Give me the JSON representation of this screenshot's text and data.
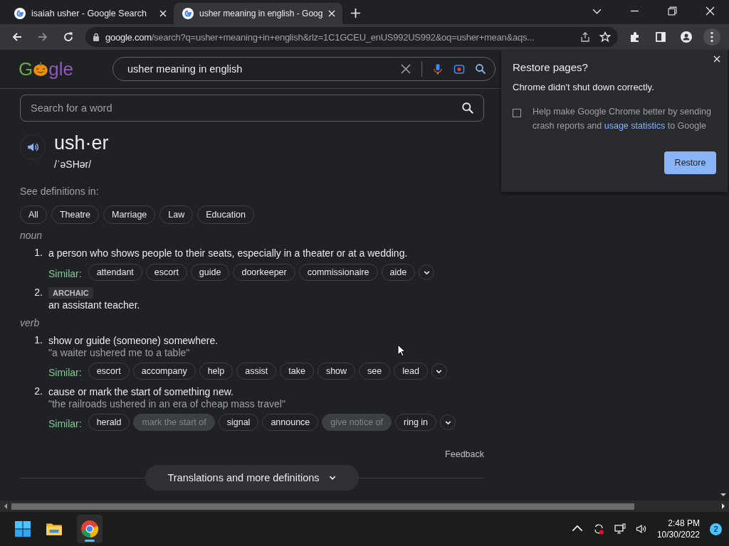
{
  "tabs": [
    {
      "title": "isaiah usher - Google Search",
      "selected": false
    },
    {
      "title": "usher meaning in english - Goog",
      "selected": true
    }
  ],
  "address_bar": {
    "domain": "google.com",
    "path": "/search?q=usher+meaning+in+english&rlz=1C1GCEU_enUS992US992&oq=usher+mean&aqs..."
  },
  "google_header": {
    "logo_before": "G",
    "logo_after": "gle",
    "query": "usher meaning in english"
  },
  "dictionary": {
    "search_placeholder": "Search for a word",
    "word": "ush·er",
    "phonetic": "/ˈəSHər/",
    "see_definitions_label": "See definitions in:",
    "filters": [
      {
        "label": "All",
        "selected": false
      },
      {
        "label": "Theatre",
        "selected": false
      },
      {
        "label": "Marriage",
        "selected": false
      },
      {
        "label": "Law",
        "selected": false
      },
      {
        "label": "Education",
        "selected": false
      }
    ],
    "parts_of_speech": [
      {
        "pos": "noun",
        "senses": [
          {
            "number": "1.",
            "text": "a person who shows people to their seats, especially in a theater or at a wedding.",
            "similar_label": "Similar:",
            "similar": [
              {
                "word": "attendant",
                "dimmed": false
              },
              {
                "word": "escort",
                "dimmed": false
              },
              {
                "word": "guide",
                "dimmed": false
              },
              {
                "word": "doorkeeper",
                "dimmed": false
              },
              {
                "word": "commissionaire",
                "dimmed": false
              },
              {
                "word": "aide",
                "dimmed": false
              }
            ]
          },
          {
            "number": "2.",
            "tag": "ARCHAIC",
            "text": "an assistant teacher."
          }
        ]
      },
      {
        "pos": "verb",
        "senses": [
          {
            "number": "1.",
            "text": "show or guide (someone) somewhere.",
            "example": "\"a waiter ushered me to a table\"",
            "similar_label": "Similar:",
            "similar": [
              {
                "word": "escort",
                "dimmed": false
              },
              {
                "word": "accompany",
                "dimmed": false
              },
              {
                "word": "help",
                "dimmed": false
              },
              {
                "word": "assist",
                "dimmed": false
              },
              {
                "word": "take",
                "dimmed": false
              },
              {
                "word": "show",
                "dimmed": false
              },
              {
                "word": "see",
                "dimmed": false
              },
              {
                "word": "lead",
                "dimmed": false
              }
            ]
          },
          {
            "number": "2.",
            "text": "cause or mark the start of something new.",
            "example": "\"the railroads ushered in an era of cheap mass travel\"",
            "similar_label": "Similar:",
            "similar": [
              {
                "word": "herald",
                "dimmed": false
              },
              {
                "word": "mark the start of",
                "dimmed": true
              },
              {
                "word": "signal",
                "dimmed": false
              },
              {
                "word": "announce",
                "dimmed": false
              },
              {
                "word": "give notice of",
                "dimmed": true
              },
              {
                "word": "ring in",
                "dimmed": false
              }
            ]
          }
        ]
      }
    ],
    "feedback": "Feedback",
    "more_button": "Translations and more definitions"
  },
  "restore_popup": {
    "title": "Restore pages?",
    "message": "Chrome didn't shut down correctly.",
    "checkbox_text_before": "Help make Google Chrome better by sending crash reports and",
    "checkbox_link": "usage statistics",
    "checkbox_text_after": "to Google",
    "checked": false,
    "button": "Restore"
  },
  "taskbar": {
    "apps": [
      {
        "kind": "explorer",
        "active": false
      },
      {
        "kind": "chrome",
        "active": true
      }
    ],
    "time": "2:48 PM",
    "date": "10/30/2022",
    "notifications": "2"
  }
}
